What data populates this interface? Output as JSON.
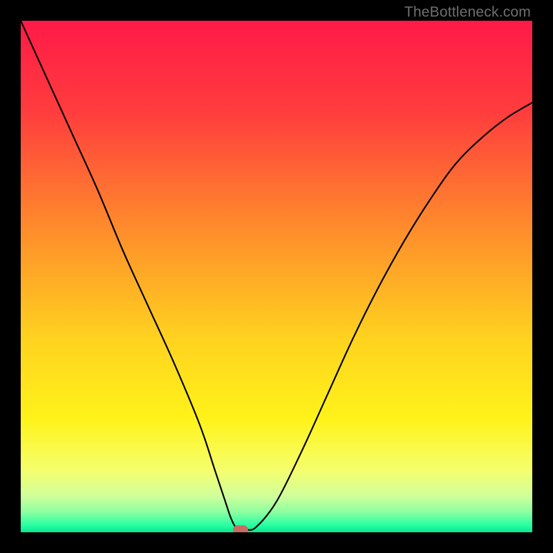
{
  "watermark": {
    "text": "TheBottleneck.com"
  },
  "chart_data": {
    "type": "line",
    "title": "",
    "xlabel": "",
    "ylabel": "",
    "xlim": [
      0,
      100
    ],
    "ylim": [
      0,
      100
    ],
    "grid": false,
    "legend": false,
    "background_gradient": {
      "stops": [
        {
          "pct": 0,
          "color": "#ff1a48"
        },
        {
          "pct": 18,
          "color": "#ff3d3d"
        },
        {
          "pct": 40,
          "color": "#ff8a2c"
        },
        {
          "pct": 62,
          "color": "#ffd21f"
        },
        {
          "pct": 78,
          "color": "#fff31a"
        },
        {
          "pct": 88,
          "color": "#f4ff6e"
        },
        {
          "pct": 93,
          "color": "#cfff9c"
        },
        {
          "pct": 96,
          "color": "#8effa0"
        },
        {
          "pct": 98.5,
          "color": "#2bffa3"
        },
        {
          "pct": 100,
          "color": "#08e890"
        }
      ]
    },
    "series": [
      {
        "name": "bottleneck-curve",
        "color": "#000000",
        "x": [
          0,
          5,
          10,
          15,
          20,
          25,
          30,
          35,
          38,
          40,
          41,
          42,
          43,
          44,
          46,
          50,
          55,
          60,
          65,
          70,
          75,
          80,
          85,
          90,
          95,
          100
        ],
        "values": [
          100,
          89,
          78,
          67,
          55,
          44,
          33,
          21,
          12,
          6,
          3,
          1,
          0.5,
          0.5,
          1,
          6,
          16,
          27,
          38,
          48,
          57,
          65,
          72,
          77,
          81,
          84
        ]
      }
    ],
    "marker": {
      "x": 43,
      "y": 0,
      "color": "#cb6a62"
    }
  }
}
